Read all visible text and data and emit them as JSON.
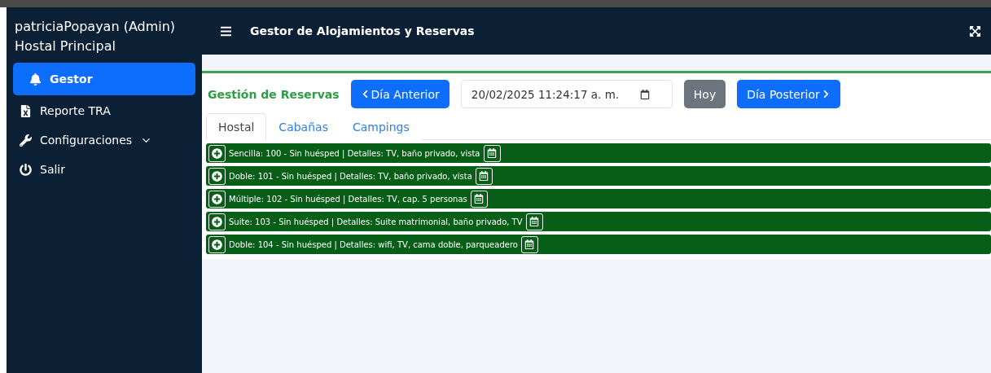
{
  "sidebar": {
    "user": "patriciaPopayan (Admin)",
    "site": "Hostal Principal",
    "items": [
      {
        "kind": "bell",
        "label": "Gestor",
        "selected": true
      },
      {
        "kind": "excel",
        "label": "Reporte TRA",
        "selected": false
      },
      {
        "kind": "wrench",
        "label": "Configuraciones",
        "selected": false,
        "dropdown": true
      },
      {
        "kind": "power",
        "label": "Salir",
        "selected": false
      }
    ]
  },
  "header": {
    "title": "Gestor de Alojamientos y Reservas"
  },
  "card": {
    "title": "Gestión de Reservas",
    "prev_button": "Día Anterior",
    "date_value": "20/02/2025 11:24:17 a. m.",
    "today_button": "Hoy",
    "next_button": "Día Posterior",
    "tabs": [
      {
        "label": "Hostal",
        "selected": true
      },
      {
        "label": "Cabañas",
        "selected": false
      },
      {
        "label": "Campings",
        "selected": false
      }
    ],
    "rooms": [
      {
        "text": "Sencilla: 100 - Sin huésped | Detalles: TV, baño privado, vista"
      },
      {
        "text": "Doble: 101 - Sin huésped | Detalles: TV, baño privado, vista"
      },
      {
        "text": "Múltiple: 102 - Sin huésped | Detalles: TV, cap. 5 personas"
      },
      {
        "text": "Suite: 103 - Sin huésped | Detalles: Suite matrimonial, baño privado, TV"
      },
      {
        "text": "Doble: 104 - Sin huésped | Detalles: wifi, TV, cama doble, parqueadero"
      }
    ]
  }
}
